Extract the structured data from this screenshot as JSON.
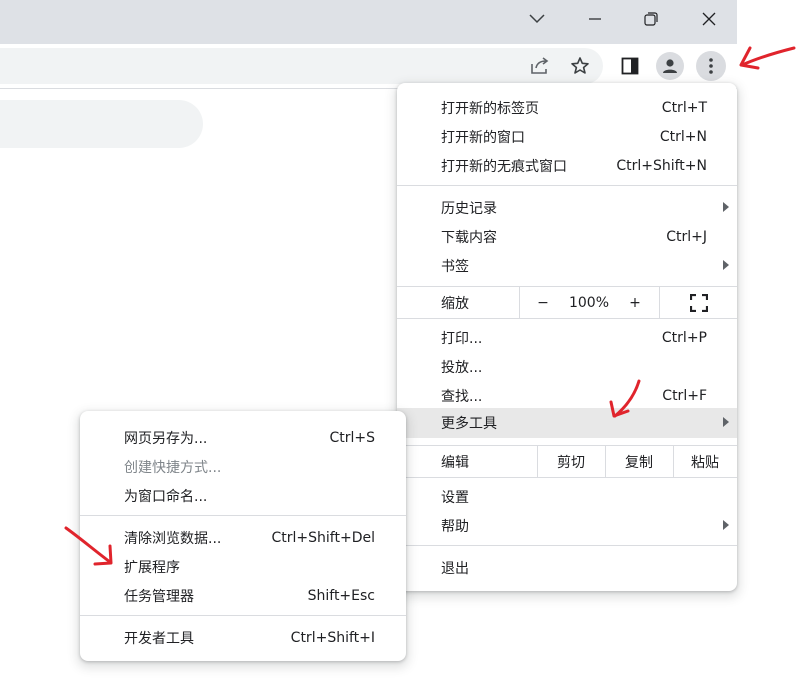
{
  "window_controls": {
    "tab_search_icon": "chevron-down-icon",
    "minimize_icon": "minimize-icon",
    "restore_icon": "restore-icon",
    "close_icon": "close-icon"
  },
  "toolbar": {
    "share_icon": "share-icon",
    "bookmark_icon": "star-icon",
    "side_panel_icon": "side-panel-icon",
    "profile_icon": "profile-icon",
    "menu_icon": "kebab-menu-icon"
  },
  "main_menu": {
    "section1": [
      {
        "label": "打开新的标签页",
        "shortcut": "Ctrl+T"
      },
      {
        "label": "打开新的窗口",
        "shortcut": "Ctrl+N"
      },
      {
        "label": "打开新的无痕式窗口",
        "shortcut": "Ctrl+Shift+N"
      }
    ],
    "section2": [
      {
        "label": "历史记录",
        "shortcut": ""
      },
      {
        "label": "下载内容",
        "shortcut": "Ctrl+J"
      },
      {
        "label": "书签",
        "shortcut": ""
      }
    ],
    "zoom": {
      "label": "缩放",
      "minus": "−",
      "value": "100%",
      "plus": "+",
      "fullscreen_icon": "fullscreen-icon"
    },
    "section3": [
      {
        "label": "打印...",
        "shortcut": "Ctrl+P"
      },
      {
        "label": "投放...",
        "shortcut": ""
      },
      {
        "label": "查找...",
        "shortcut": "Ctrl+F"
      },
      {
        "label": "更多工具",
        "shortcut": ""
      }
    ],
    "edit": {
      "label": "编辑",
      "cut": "剪切",
      "copy": "复制",
      "paste": "粘贴"
    },
    "section4": [
      {
        "label": "设置",
        "shortcut": ""
      },
      {
        "label": "帮助",
        "shortcut": ""
      }
    ],
    "exit": {
      "label": "退出"
    }
  },
  "sub_menu": {
    "section1": [
      {
        "label": "网页另存为...",
        "shortcut": "Ctrl+S"
      },
      {
        "label": "创建快捷方式...",
        "shortcut": ""
      },
      {
        "label": "为窗口命名...",
        "shortcut": ""
      }
    ],
    "section2": [
      {
        "label": "清除浏览数据...",
        "shortcut": "Ctrl+Shift+Del"
      },
      {
        "label": "扩展程序",
        "shortcut": ""
      },
      {
        "label": "任务管理器",
        "shortcut": "Shift+Esc"
      }
    ],
    "section3": [
      {
        "label": "开发者工具",
        "shortcut": "Ctrl+Shift+I"
      }
    ]
  },
  "colors": {
    "annotation_red": "#e0242c",
    "titlebar": "#dee1e6",
    "highlight": "#e8e8e8"
  }
}
